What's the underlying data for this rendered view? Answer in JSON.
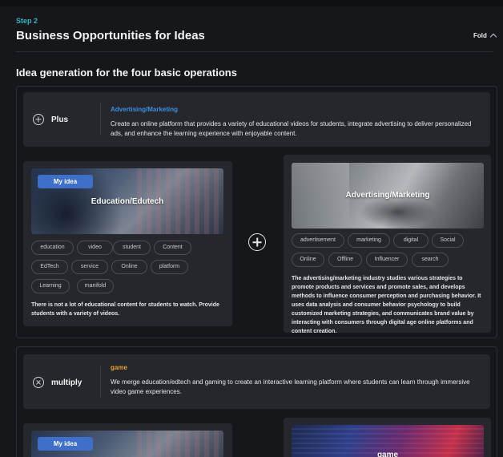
{
  "header": {
    "step": "Step 2",
    "title": "Business Opportunities for Ideas",
    "fold_label": "Fold",
    "fold_icon": "chevron-up-icon"
  },
  "section": {
    "title": "Idea generation for the four basic operations"
  },
  "operations": [
    {
      "label": "Plus",
      "icon": "plus-circle-icon",
      "category": "Advertising/Marketing",
      "category_color": "#3a8fe0",
      "description": "Create an online platform that provides a variety of educational videos for students, integrate advertising to deliver personalized ads, and enhance the learning experience with enjoyable content.",
      "left_card": {
        "badge": "My idea",
        "title": "Education/Edutech",
        "tags": [
          "education",
          "video",
          "student",
          "Content",
          "EdTech",
          "service",
          "Online",
          "platform",
          "Learning",
          "manifold"
        ],
        "description": "There is not a lot of educational content for students to watch. Provide students with a variety of videos."
      },
      "right_card": {
        "title": "Advertising/Marketing",
        "tags": [
          "advertisement",
          "marketing",
          "digital",
          "Social",
          "Online",
          "Offline",
          "Influencer",
          "search"
        ],
        "description": "The advertising/marketing industry studies various strategies to promote products and services and promote sales, and develops methods to influence consumer perception and purchasing behavior. It uses data analysis and consumer behavior psychology to build customized marketing strategies, and communicates brand value by interacting with consumers through digital age online platforms and content creation."
      }
    },
    {
      "label": "multiply",
      "icon": "times-circle-icon",
      "category": "game",
      "category_color": "#e7a42c",
      "description": "We merge education/edtech and gaming to create an interactive learning platform where students can learn through immersive video game experiences.",
      "left_card": {
        "badge": "My idea",
        "title": ""
      },
      "right_card": {
        "title": "game"
      }
    }
  ]
}
